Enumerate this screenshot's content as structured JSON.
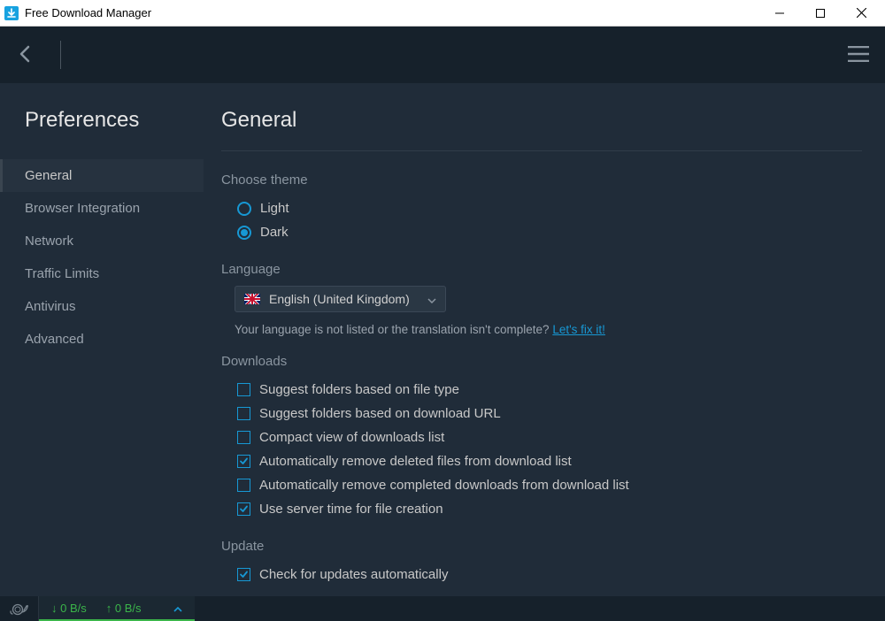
{
  "window": {
    "title": "Free Download Manager"
  },
  "sidebar": {
    "title": "Preferences",
    "items": [
      {
        "label": "General",
        "active": true
      },
      {
        "label": "Browser Integration",
        "active": false
      },
      {
        "label": "Network",
        "active": false
      },
      {
        "label": "Traffic Limits",
        "active": false
      },
      {
        "label": "Antivirus",
        "active": false
      },
      {
        "label": "Advanced",
        "active": false
      }
    ]
  },
  "content": {
    "heading": "General",
    "theme": {
      "label": "Choose theme",
      "options": [
        {
          "label": "Light",
          "selected": false
        },
        {
          "label": "Dark",
          "selected": true
        }
      ]
    },
    "language": {
      "label": "Language",
      "selected": "English (United Kingdom)",
      "noteprefix": "Your language is not listed or the translation isn't complete? ",
      "notelink": "Let's fix it!"
    },
    "downloads": {
      "label": "Downloads",
      "options": [
        {
          "label": "Suggest folders based on file type",
          "checked": false
        },
        {
          "label": "Suggest folders based on download URL",
          "checked": false
        },
        {
          "label": "Compact view of downloads list",
          "checked": false
        },
        {
          "label": "Automatically remove deleted files from download list",
          "checked": true
        },
        {
          "label": "Automatically remove completed downloads from download list",
          "checked": false
        },
        {
          "label": "Use server time for file creation",
          "checked": true
        }
      ]
    },
    "update": {
      "label": "Update",
      "options": [
        {
          "label": "Check for updates automatically",
          "checked": true
        }
      ]
    }
  },
  "status": {
    "down": "0 B/s",
    "up": "0 B/s"
  }
}
